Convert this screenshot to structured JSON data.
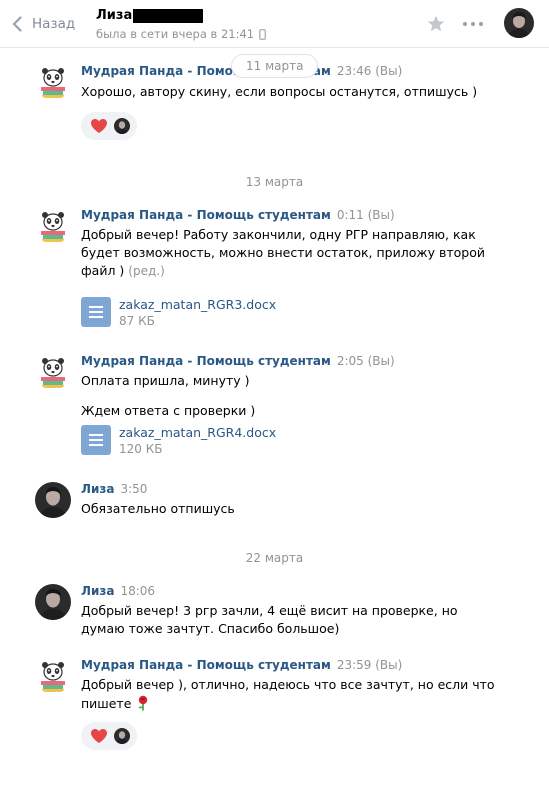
{
  "header": {
    "back_label": "Назад",
    "peer_name": "Лиза",
    "peer_status": "была в сети вчера в 21:41"
  },
  "floating_date": "11 марта",
  "date_separators": [
    "13 марта",
    "22 марта"
  ],
  "messages": [
    {
      "author": "Мудрая Панда - Помощь студентам",
      "time": "23:46 (Вы)",
      "lines": [
        "Хорошо, автору скину, если вопросы останутся, отпишусь )"
      ],
      "reaction": "heart"
    },
    {
      "author": "Мудрая Панда - Помощь студентам",
      "time": "0:11 (Вы)",
      "lines": [
        "Добрый вечер! Работу закончили, одну РГР направляю, как",
        "будет возможность, можно внести остаток, приложу второй",
        "файл )"
      ],
      "edited": "(ред.)",
      "attachment": {
        "name": "zakaz_matan_RGR3.docx",
        "size": "87 КБ"
      }
    },
    {
      "author": "Мудрая Панда - Помощь студентам",
      "time": "2:05 (Вы)",
      "lines": [
        "Оплата пришла, минуту )",
        "Ждем ответа с проверки )"
      ],
      "attachment": {
        "name": "zakaz_matan_RGR4.docx",
        "size": "120 КБ"
      }
    },
    {
      "author": "Лиза",
      "time": "3:50",
      "lines": [
        "Обязательно отпишусь"
      ]
    },
    {
      "author": "Лиза",
      "time": "18:06",
      "lines": [
        "Добрый вечер! 3 ргр зачли, 4 ещё висит на проверке, но",
        "думаю тоже зачтут. Спасибо большое)"
      ]
    },
    {
      "author": "Мудрая Панда - Помощь студентам",
      "time": "23:59 (Вы)",
      "lines": [
        "Добрый вечер ), отлично, надеюсь что все зачтут, но если что",
        "пишете"
      ],
      "emoji": "rose",
      "reaction": "heart"
    }
  ],
  "colors": {
    "link": "#2a5885",
    "muted": "#939393",
    "doc_icon": "#7fa7d3",
    "reaction_bg": "#f0f2f5",
    "heart": "#e64646"
  }
}
